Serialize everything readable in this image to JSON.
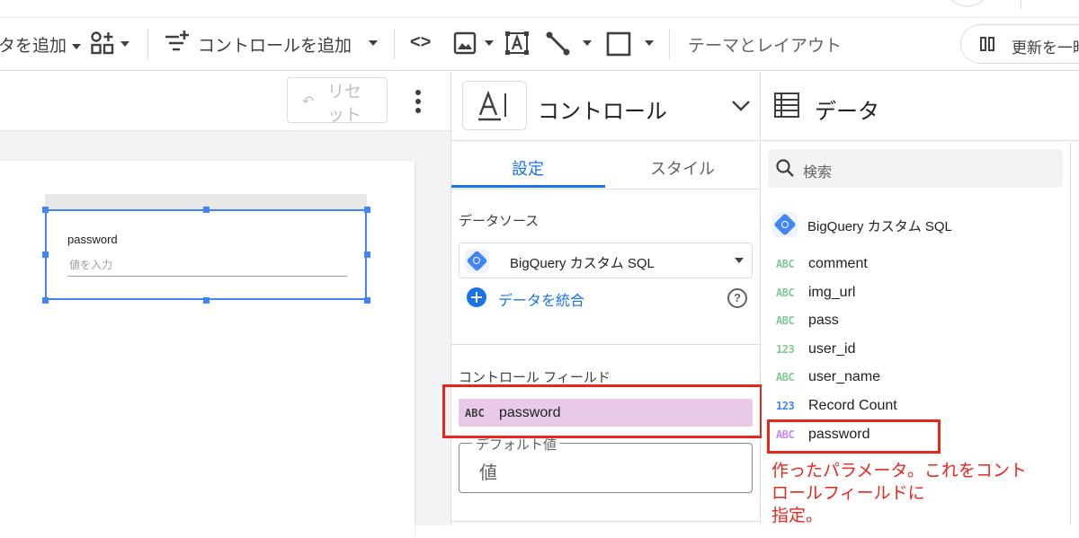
{
  "toolbar": {
    "add_data_label": "タを追加",
    "add_control_label": "コントロールを追加",
    "theme_layout_label": "テーマとレイアウト",
    "refresh_label": "更新を一時",
    "code_icon_text": "<>"
  },
  "canvas": {
    "reset_label_line1": "リセ",
    "reset_label_line2": "ット",
    "control_title": "password",
    "control_placeholder": "値を入力"
  },
  "properties": {
    "header_title": "コントロール",
    "tabs": [
      "設定",
      "スタイル"
    ],
    "active_tab": "設定",
    "data_source_heading": "データソース",
    "data_source_value": "BigQuery カスタム SQL",
    "blend_link": "データを統合",
    "help_icon_text": "?",
    "control_field_heading": "コントロール フィールド",
    "control_field_type": "ABC",
    "control_field_name": "password",
    "default_value_legend": "デフォルト値",
    "default_value_text": "値"
  },
  "data_panel": {
    "title": "データ",
    "search_placeholder": "検索",
    "source_name": "BigQuery カスタム SQL",
    "fields": [
      {
        "type": "ABC",
        "name": "comment"
      },
      {
        "type": "ABC",
        "name": "img_url"
      },
      {
        "type": "ABC",
        "name": "pass"
      },
      {
        "type": "123",
        "name": "user_id"
      },
      {
        "type": "ABC",
        "name": "user_name"
      },
      {
        "type": "123",
        "name": "Record Count"
      },
      {
        "type": "ABC",
        "name": "password"
      }
    ]
  },
  "annotation": {
    "line1": "作ったパラメータ。これをコント",
    "line2": "ロールフィールドに",
    "line3": "指定。"
  },
  "colors": {
    "accent_blue": "#1a73e8",
    "selection_blue": "#4285f4",
    "field_highlight": "#e8c9e7",
    "annotation_red": "#e8261c",
    "type_green": "#81c995",
    "type_blue": "#4285f4",
    "type_purple": "#c58af9"
  }
}
